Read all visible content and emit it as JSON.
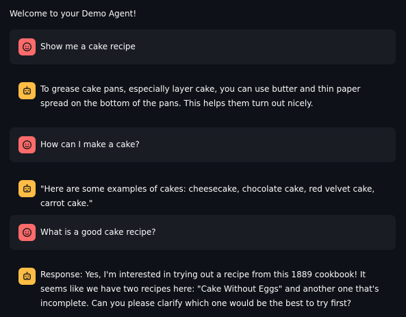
{
  "app": {
    "title": "Welcome to your Demo Agent!"
  },
  "messages": [
    {
      "role": "user",
      "avatar_icon": "user-face-icon",
      "text": "Show me a cake recipe"
    },
    {
      "role": "assistant",
      "avatar_icon": "robot-icon",
      "text": "To grease cake pans, especially layer cake, you can use butter and thin paper spread on the bottom of the pans. This helps them turn out nicely."
    },
    {
      "role": "user",
      "avatar_icon": "user-face-icon",
      "text": "How can I make a cake?"
    },
    {
      "role": "assistant",
      "avatar_icon": "robot-icon",
      "text": "\"Here are some examples of cakes: cheesecake, chocolate cake, red velvet cake, carrot cake.\""
    },
    {
      "role": "user",
      "avatar_icon": "user-face-icon",
      "text": "What is a good cake recipe?"
    },
    {
      "role": "assistant",
      "avatar_icon": "robot-icon",
      "text": "Response: Yes, I'm interested in trying out a recipe from this 1889 cookbook! It seems like we have two recipes here: \"Cake Without Eggs\" and another one that's incomplete. Can you please clarify which one would be the best to try first?"
    }
  ],
  "colors": {
    "background": "#0e1117",
    "user_message_bg": "#1a1c24",
    "user_avatar": "#ff6b6b",
    "assistant_avatar": "#ffbd45",
    "text": "#fafafa"
  }
}
